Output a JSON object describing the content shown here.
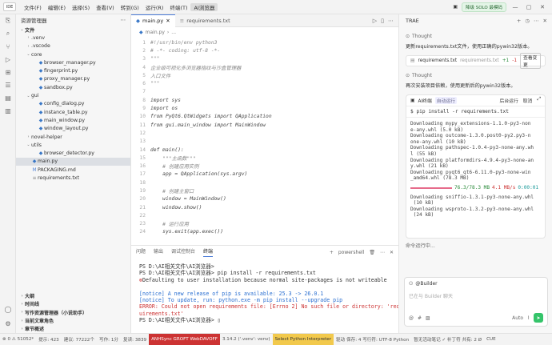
{
  "titlebar": {
    "ide_label": "IDE",
    "menus": [
      "文件(F)",
      "编辑(E)",
      "选择(S)",
      "查看(V)",
      "转到(G)",
      "运行(R)",
      "终端(T)",
      "AI浏览器"
    ],
    "solo_label": "降级 SOLO 最模码"
  },
  "sidebar": {
    "title": "资源管理器",
    "section": "文件",
    "items": [
      {
        "label": ".venv",
        "type": "folder",
        "level": 1,
        "chev": "›"
      },
      {
        "label": ".vscode",
        "type": "folder",
        "level": 1,
        "chev": "›"
      },
      {
        "label": "core",
        "type": "folder",
        "level": 1,
        "chev": "⌄"
      },
      {
        "label": "browser_manager.py",
        "type": "py",
        "level": 2
      },
      {
        "label": "fingerprint.py",
        "type": "py",
        "level": 2
      },
      {
        "label": "proxy_manager.py",
        "type": "py",
        "level": 2
      },
      {
        "label": "sandbox.py",
        "type": "py",
        "level": 2
      },
      {
        "label": "gui",
        "type": "folder",
        "level": 1,
        "chev": "⌄"
      },
      {
        "label": "config_dialog.py",
        "type": "py",
        "level": 2
      },
      {
        "label": "instance_table.py",
        "type": "py",
        "level": 2
      },
      {
        "label": "main_window.py",
        "type": "py",
        "level": 2
      },
      {
        "label": "window_layout.py",
        "type": "py",
        "level": 2
      },
      {
        "label": "novel-helper",
        "type": "folder",
        "level": 1,
        "chev": "›"
      },
      {
        "label": "utils",
        "type": "folder",
        "level": 1,
        "chev": "⌄"
      },
      {
        "label": "browser_detector.py",
        "type": "py",
        "level": 2
      },
      {
        "label": "main.py",
        "type": "py",
        "level": 1,
        "selected": true
      },
      {
        "label": "PACKAGING.md",
        "type": "md",
        "level": 1
      },
      {
        "label": "requirements.txt",
        "type": "txt",
        "level": 1
      }
    ],
    "outline": [
      "大纲",
      "时间线",
      "写作资源管理器（小说助手）",
      "当前文章角色",
      "章节概述"
    ]
  },
  "editor": {
    "tabs": [
      {
        "label": "main.py",
        "active": true
      },
      {
        "label": "requirements.txt",
        "active": false
      }
    ],
    "breadcrumb": [
      "main.py",
      "..."
    ],
    "lines": [
      {
        "n": "1",
        "text": "#!/usr/bin/env python3",
        "cls": "c-com"
      },
      {
        "n": "2",
        "text": "# -*- coding: utf-8 -*-",
        "cls": "c-com"
      },
      {
        "n": "3",
        "text": "\"\"\"",
        "cls": "c-com"
      },
      {
        "n": "4",
        "text": "企业级可视化多浏览器指纹与沙盒管理器",
        "cls": "c-com"
      },
      {
        "n": "5",
        "text": "入口文件",
        "cls": "c-com"
      },
      {
        "n": "6",
        "text": "\"\"\"",
        "cls": "c-com"
      },
      {
        "n": "7",
        "text": "",
        "cls": ""
      },
      {
        "n": "8",
        "text": "import sys",
        "cls": "c-it"
      },
      {
        "n": "9",
        "text": "import os",
        "cls": "c-it"
      },
      {
        "n": "10",
        "text": "from PyQt6.QtWidgets import QApplication",
        "cls": "c-it"
      },
      {
        "n": "11",
        "text": "from gui.main_window import MainWindow",
        "cls": "c-it"
      },
      {
        "n": "12",
        "text": "",
        "cls": ""
      },
      {
        "n": "13",
        "text": "",
        "cls": ""
      },
      {
        "n": "14",
        "text": "def main():",
        "cls": "c-it"
      },
      {
        "n": "15",
        "text": "    \"\"\"主函数\"\"\"",
        "cls": "c-com"
      },
      {
        "n": "16",
        "text": "    # 创建应用实例",
        "cls": "c-com"
      },
      {
        "n": "17",
        "text": "    app = QApplication(sys.argv)",
        "cls": "c-it"
      },
      {
        "n": "18",
        "text": "",
        "cls": ""
      },
      {
        "n": "19",
        "text": "    # 创建主窗口",
        "cls": "c-com"
      },
      {
        "n": "20",
        "text": "    window = MainWindow()",
        "cls": "c-it"
      },
      {
        "n": "21",
        "text": "    window.show()",
        "cls": "c-it"
      },
      {
        "n": "22",
        "text": "",
        "cls": ""
      },
      {
        "n": "23",
        "text": "    # 运行应用",
        "cls": "c-com"
      },
      {
        "n": "24",
        "text": "    sys.exit(app.exec())",
        "cls": "c-it"
      }
    ]
  },
  "panel": {
    "tabs": [
      "问题",
      "输出",
      "调试控制台",
      "终端"
    ],
    "active_tab": "终端",
    "shell": "powershell",
    "lines": [
      {
        "text": "PS D:\\AI相关文件\\AI浏览器> ",
        "cls": ""
      },
      {
        "text": "PS D:\\AI相关文件\\AI浏览器> pip install -r requirements.txt",
        "cls": ""
      },
      {
        "text": "Defaulting to user installation because normal site-packages is not writeable",
        "cls": "",
        "dot": true
      },
      {
        "text": "",
        "cls": ""
      },
      {
        "text": "[notice] A new release of pip is available: 25.3 -> 26.0.1",
        "cls": "t-blue"
      },
      {
        "text": "[notice] To update, run: python.exe -m pip install --upgrade pip",
        "cls": "t-blue"
      },
      {
        "text": "ERROR: Could not open requirements file: [Errno 2] No such file or directory: 'req",
        "cls": "t-err"
      },
      {
        "text": "uirements.txt'",
        "cls": "t-err"
      },
      {
        "text": "PS D:\\AI相关文件\\AI浏览器> ▯",
        "cls": ""
      }
    ]
  },
  "rpanel": {
    "title": "TRAE",
    "thought1": "Thought",
    "text1": "更新requirements.txt文件，使用正确的pywin32版本。",
    "file": {
      "name": "requirements.txt",
      "path": "requirements.txt",
      "plus": "+1",
      "minus": "-1",
      "view": "查看变更"
    },
    "thought2": "Thought",
    "text2": "再次安装项目依赖，使用更新后的pywin32版本。",
    "term": {
      "title": "AI终端",
      "badge": "自动运行",
      "bg": "后台运行",
      "cancel": "取消",
      "command": "$ pip install -r requirements.txt",
      "output": [
        "Downloading mypy_extensions-1.1.0-py3-non",
        "e-any.whl (5.0 kB)",
        "Downloading outcome-1.3.0.post0-py2.py3-n",
        "one-any.whl (10 kB)",
        "Downloading pathspec-1.0.4-py3-none-any.wh",
        "l (55 kB)",
        "Downloading platformdirs-4.9.4-py3-none-an",
        "y.whl (21 kB)",
        "Downloading pyqt6_qt6-6.11.0-py3-none-win",
        "_amd64.whl (78.3 MB)"
      ],
      "progress": {
        "fraction": 1.0,
        "size": "76.3/78.3 MB",
        "speed": "4.1 MB/s",
        "eta": "0:00:01"
      },
      "output2": [
        "Downloading sniffio-1.3.1-py3-none-any.whl",
        " (10 kB)",
        "Downloading wsproto-1.3.2-py3-none-any.whl",
        " (24 kB)"
      ]
    },
    "status": "命令运行中...",
    "chat": {
      "mention": "@Builder",
      "placeholder": "已在与 Builder 聊天",
      "mode": "Auto"
    }
  },
  "statusbar": {
    "items": [
      "⊗ 0  ⚠ 51052*",
      "提示: 423",
      "建议: 77222个",
      "写作: 1分",
      "复读: 3839",
      "ANHSync GROFT WebDAVOFF",
      "3.14.2 ('.venv': venv)",
      "Select Python Interpreter",
      "驱动  保存: 4  写行符: UTF-8  Python",
      "暂无活动笔记  ✓ 补丁符  共有: 2 Ø",
      "CUE"
    ]
  },
  "colors": {
    "accent": "#4a7bd8",
    "error": "#cc3333",
    "success": "#2a8a3a",
    "send": "#35c46a",
    "progress": "#e66b8b"
  }
}
